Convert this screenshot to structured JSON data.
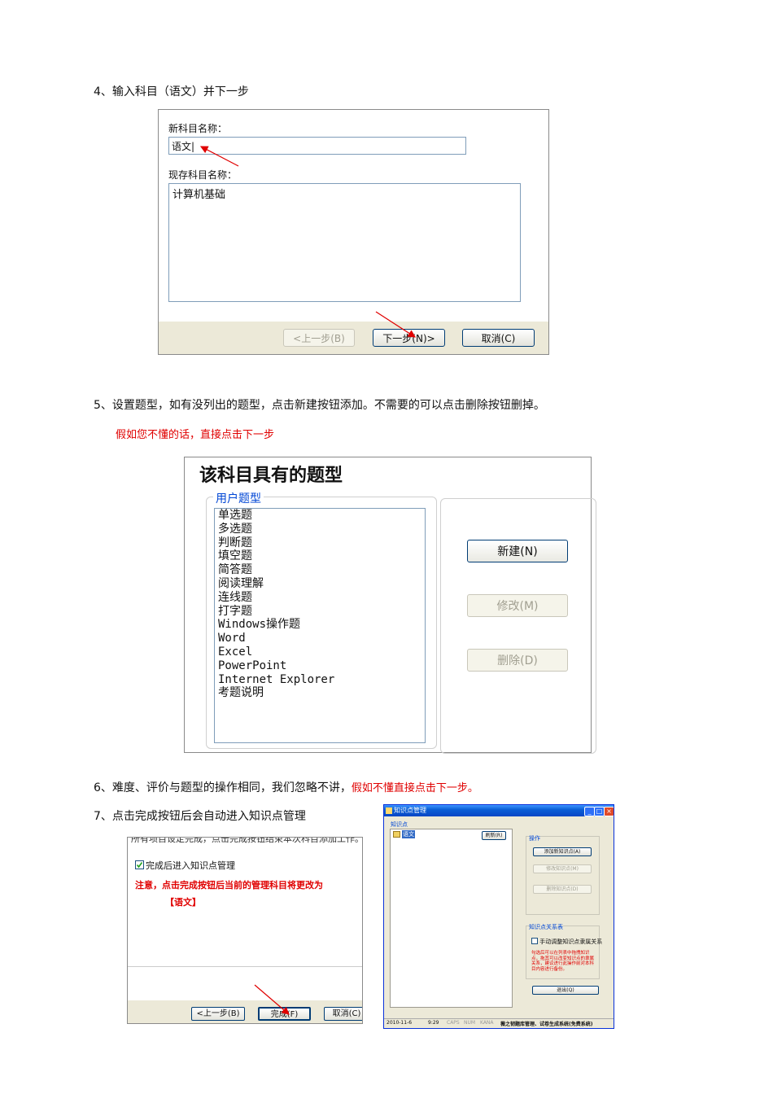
{
  "steps": {
    "s4": "4、输入科目（语文）并下一步",
    "s5": "5、设置题型，如有没列出的题型，点击新建按钮添加。不需要的可以点击删除按钮删掉。",
    "s5_note": "假如您不懂的话，直接点击下一步",
    "s6_a": "6、难度、评价与题型的操作相同，我们忽略不讲，",
    "s6_b": "假如不懂直接点击下一步。",
    "s7": "7、点击完成按钮后会自动进入知识点管理"
  },
  "dialog_new_subject": {
    "new_label": "新科目名称：",
    "new_value": "语文|",
    "existing_label": "现存科目名称：",
    "existing_items": [
      "计算机基础"
    ],
    "prev_button": "<上一步(B)",
    "next_button": "下一步(N)>",
    "cancel_button": "取消(C)"
  },
  "dialog_question_types": {
    "title": "该科目具有的题型",
    "group_label": "用户题型",
    "types": [
      "单选题",
      "多选题",
      "判断题",
      "填空题",
      "简答题",
      "阅读理解",
      "连线题",
      "打字题",
      "Windows操作题",
      "Word",
      "Excel",
      "PowerPoint",
      "Internet Explorer",
      "考题说明"
    ],
    "new_button": "新建(N)",
    "modify_button": "修改(M)",
    "delete_button": "删除(D)"
  },
  "dialog_finish": {
    "cut_text": "所有项目设定完成，点击完成按钮结束本次科目添加工作。",
    "checkbox_label": "完成后进入知识点管理",
    "checkbox_checked": true,
    "warning": "注意，点击完成按钮后当前的管理科目将更改为",
    "subject": "【语文】",
    "prev_button": "<上一步(B)",
    "finish_button": "完成(F)",
    "cancel_button": "取消(C)"
  },
  "dialog_knowledge": {
    "window_title": "知识点管理",
    "list_label": "知识点",
    "tree_item": "语文",
    "refresh_button": "刷新(R)",
    "ops_label": "操作",
    "add_button": "添加新知识点(A)",
    "modify_button": "修改知识点(M)",
    "delete_button": "删除知识点(D)",
    "relation_label": "知识点关系表",
    "manual_checkbox": "手动调整知识点隶属关系",
    "hint": "勾选后可以在列表中拖拽知识点，拖其可以改变知识点的隶属关系，建议进行此操作前对本科目内容进行备份。",
    "exit_button": "退出(Q)",
    "status": {
      "date": "2010-11-6",
      "time": "9:29",
      "caps": "CAPS",
      "num": "NUM",
      "kana": "KANA",
      "app": "薇之韧题库管理、试卷生成系统(免费系统)"
    }
  }
}
